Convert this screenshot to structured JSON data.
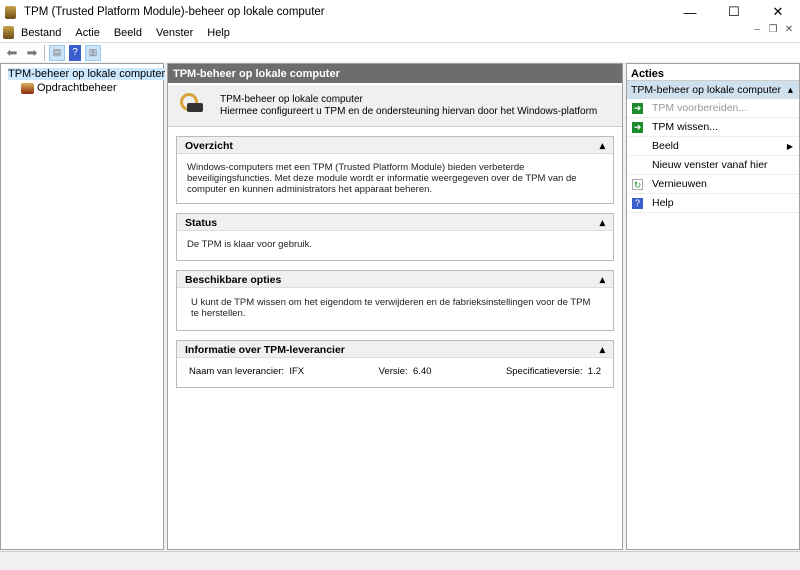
{
  "window": {
    "title": "TPM (Trusted Platform Module)-beheer op lokale computer",
    "minimize": "—",
    "maximize": "☐",
    "close": "✕"
  },
  "menu": [
    "Bestand",
    "Actie",
    "Beeld",
    "Venster",
    "Help"
  ],
  "tree": [
    "TPM-beheer op lokale computer",
    "Opdrachtbeheer"
  ],
  "center": {
    "header": "TPM-beheer op lokale computer",
    "intro_title": "TPM-beheer op lokale computer",
    "intro_desc": "Hiermee configureert u TPM en de ondersteuning hiervan door het Windows-platform",
    "overview": {
      "title": "Overzicht",
      "text": "Windows-computers met een TPM (Trusted Platform Module) bieden verbeterde beveiligingsfuncties. Met deze module wordt er informatie weergegeven over de TPM van de computer en kunnen administrators het apparaat beheren."
    },
    "status": {
      "title": "Status",
      "text": "De TPM is klaar voor gebruik."
    },
    "options": {
      "title": "Beschikbare opties",
      "text": "U kunt de TPM wissen om het eigendom te verwijderen en de fabrieksinstellingen voor de TPM te herstellen."
    },
    "vendor": {
      "title": "Informatie over TPM-leverancier",
      "name_label": "Naam van leverancier:",
      "name": "IFX",
      "version_label": "Versie:",
      "version": "6.40",
      "spec_label": "Specificatieversie:",
      "spec": "1.2"
    }
  },
  "actions": {
    "header": "Acties",
    "section": "TPM-beheer op lokale computer",
    "items": [
      "TPM voorbereiden...",
      "TPM wissen...",
      "Beeld",
      "Nieuw venster vanaf hier",
      "Vernieuwen",
      "Help"
    ]
  }
}
